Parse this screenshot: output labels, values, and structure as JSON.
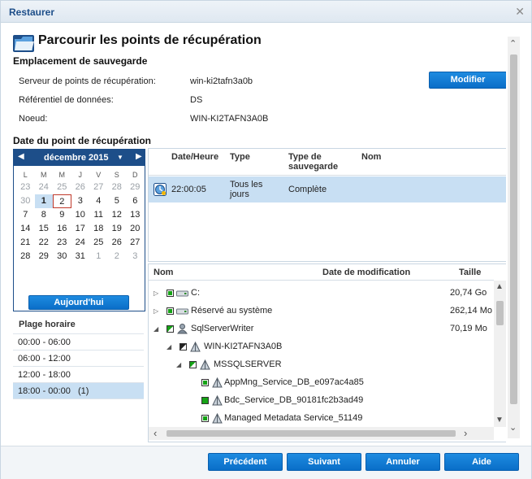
{
  "window": {
    "title": "Restaurer"
  },
  "header": {
    "title": "Parcourir les points de récupération"
  },
  "backup_location": {
    "section_title": "Emplacement de sauvegarde",
    "server_label": "Serveur de points de récupération:",
    "server_value": "win-ki2tafn3a0b",
    "datastore_label": "Référentiel de données:",
    "datastore_value": "DS",
    "node_label": "Noeud:",
    "node_value": "WIN-KI2TAFN3A0B",
    "modify_label": "Modifier"
  },
  "recovery_date": {
    "section_title": "Date du point de récupération",
    "month": "décembre 2015",
    "weekdays": [
      "L",
      "M",
      "M",
      "J",
      "V",
      "S",
      "D"
    ],
    "weeks": [
      [
        "23",
        "24",
        "25",
        "26",
        "27",
        "28",
        "29"
      ],
      [
        "30",
        "1",
        "2",
        "3",
        "4",
        "5",
        "6"
      ],
      [
        "7",
        "8",
        "9",
        "10",
        "11",
        "12",
        "13"
      ],
      [
        "14",
        "15",
        "16",
        "17",
        "18",
        "19",
        "20"
      ],
      [
        "21",
        "22",
        "23",
        "24",
        "25",
        "26",
        "27"
      ],
      [
        "28",
        "29",
        "30",
        "31",
        "1",
        "2",
        "3"
      ]
    ],
    "today_label": "Aujourd'hui"
  },
  "time_ranges": {
    "title": "Plage horaire",
    "items": [
      "00:00 - 06:00",
      "06:00 - 12:00",
      "12:00 - 18:00",
      "18:00 - 00:00   (1)"
    ]
  },
  "recovery_points": {
    "headers": {
      "time": "Date/Heure",
      "type": "Type",
      "backup_type": "Type de sauvegarde",
      "name": "Nom"
    },
    "rows": [
      {
        "time": "22:00:05",
        "type": "Tous les jours",
        "backup_type": "Complète",
        "name": ""
      }
    ]
  },
  "tree": {
    "headers": {
      "name": "Nom",
      "modified": "Date de modification",
      "size": "Taille"
    },
    "rows": [
      {
        "label": "C:",
        "size": "20,74 Go"
      },
      {
        "label": "Réservé au système",
        "size": "262,14 Mo"
      },
      {
        "label": "SqlServerWriter",
        "size": "70,19 Mo"
      },
      {
        "label": "WIN-KI2TAFN3A0B",
        "size": ""
      },
      {
        "label": "MSSQLSERVER",
        "size": ""
      },
      {
        "label": "AppMng_Service_DB_e097ac4a85",
        "size": ""
      },
      {
        "label": "Bdc_Service_DB_90181fc2b3ad49",
        "size": ""
      },
      {
        "label": "Managed Metadata Service_51149",
        "size": ""
      }
    ]
  },
  "footer": {
    "previous": "Précédent",
    "next": "Suivant",
    "cancel": "Annuler",
    "help": "Aide"
  },
  "colors": {
    "accent": "#0a6ec8",
    "header_navy": "#1d4e89",
    "selection": "#c8dff3"
  }
}
